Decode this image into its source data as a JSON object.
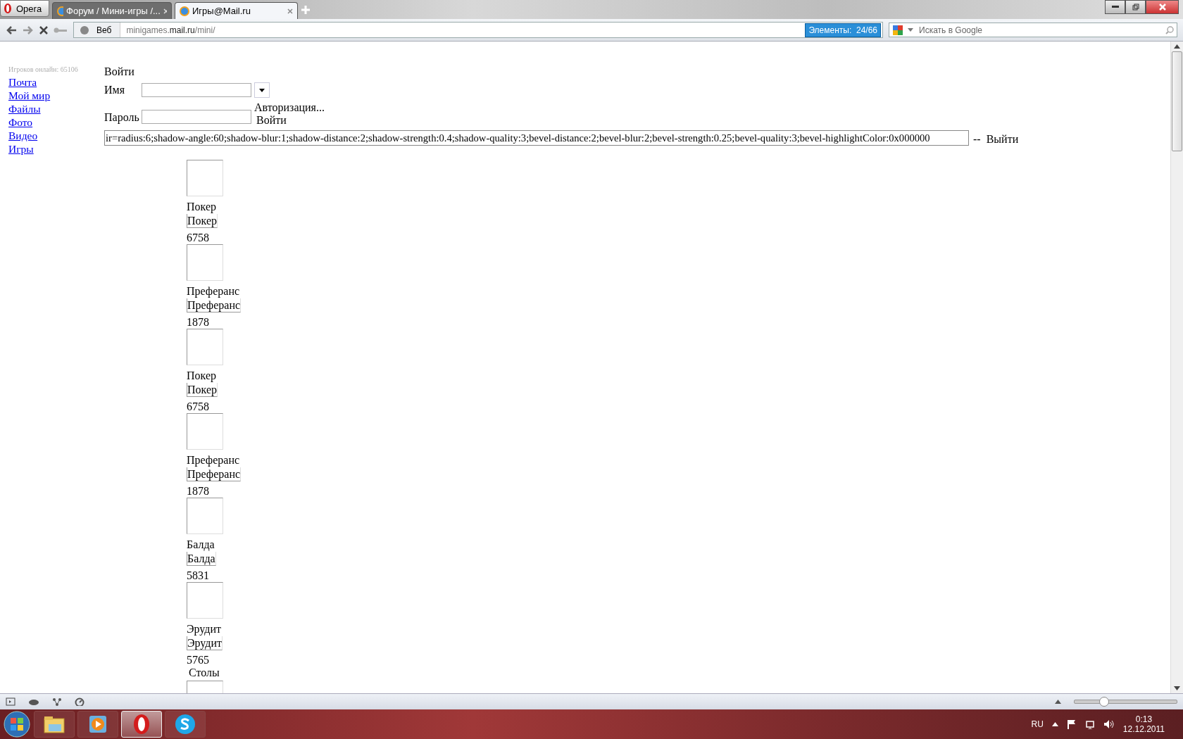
{
  "browser": {
    "menu_label": "Opera",
    "tabs": [
      {
        "title": "Форум / Мини-игры /...",
        "selected": false
      },
      {
        "title": "Игры@Mail.ru",
        "selected": true
      }
    ],
    "address": {
      "scheme_label": "Веб",
      "host_prefix": "minigames.",
      "host_domain": "mail.ru",
      "path": "/mini/"
    },
    "blocked_badge": "Элементы:  24/66",
    "search": {
      "placeholder": "Искать в Google"
    }
  },
  "page": {
    "online_count": "Игроков онлайн: 65106",
    "nav_links": [
      "Почта",
      "Мой мир",
      "Файлы",
      "Фото",
      "Видео",
      "Игры"
    ],
    "login": {
      "title": "Войти",
      "name_label": "Имя",
      "password_label": "Пароль",
      "auth_text": "Авторизация...",
      "submit": "Войти"
    },
    "style_field": {
      "value": "ir=radius:6;shadow-angle:60;shadow-blur:1;shadow-distance:2;shadow-strength:0.4;shadow-quality:3;bevel-distance:2;bevel-blur:2;bevel-strength:0.25;bevel-quality:3;bevel-highlightColor:0x000000"
    },
    "separator": "--",
    "logout": "Выйти",
    "games": [
      {
        "name": "Покер",
        "link_label": "Покер",
        "count": "6758"
      },
      {
        "name": "Преферанс",
        "link_label": "Преферанс",
        "count": "1878"
      },
      {
        "name": "Покер",
        "link_label": "Покер",
        "count": "6758"
      },
      {
        "name": "Преферанс",
        "link_label": "Преферанс",
        "count": "1878"
      },
      {
        "name": "Балда",
        "link_label": "Балда",
        "count": "5831"
      },
      {
        "name": "Эрудит",
        "link_label": "Эрудит",
        "count": "5765"
      }
    ],
    "tables_heading": "Столы"
  },
  "status_bar": {
    "zoom": {
      "level": 0.28
    }
  },
  "taskbar": {
    "apps": [
      {
        "kind": "explorer",
        "selected": false
      },
      {
        "kind": "media",
        "selected": false
      },
      {
        "kind": "opera",
        "selected": true
      },
      {
        "kind": "skype",
        "selected": false
      }
    ],
    "language": "RU",
    "time": "0:13",
    "date": "12.12.2011"
  }
}
